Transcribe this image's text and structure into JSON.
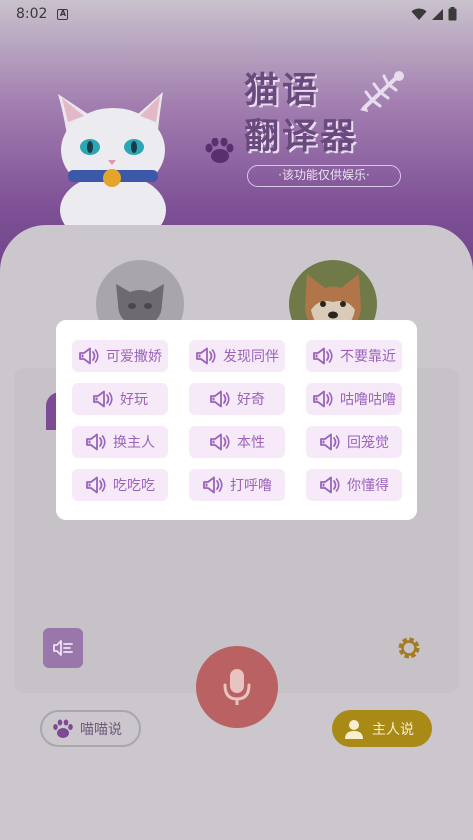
{
  "status_bar": {
    "time": "8:02",
    "notification_glyph": "A",
    "icons": [
      "wifi-icon",
      "signal-icon",
      "battery-icon"
    ]
  },
  "header": {
    "title_line1": "猫语",
    "title_line2": "翻译器",
    "subtitle": "·该功能仅供娱乐·"
  },
  "avatars": {
    "cat": "gray-cat-avatar",
    "dog": "shiba-dog-avatar"
  },
  "dialog": {
    "phrases": [
      {
        "label": "可爱撒娇"
      },
      {
        "label": "发现同伴"
      },
      {
        "label": "不要靠近"
      },
      {
        "label": "好玩"
      },
      {
        "label": "好奇"
      },
      {
        "label": "咕噜咕噜"
      },
      {
        "label": "换主人"
      },
      {
        "label": "本性"
      },
      {
        "label": "回笼觉"
      },
      {
        "label": "吃吃吃"
      },
      {
        "label": "打呼噜"
      },
      {
        "label": "你懂得"
      }
    ]
  },
  "controls": {
    "meow_label": "喵喵说",
    "owner_label": "主人说"
  },
  "colors": {
    "accent_purple": "#9b63ba",
    "phrase_bg": "#f6eaf9",
    "mic_red": "#e57373",
    "owner_gold": "#e8b81f"
  }
}
